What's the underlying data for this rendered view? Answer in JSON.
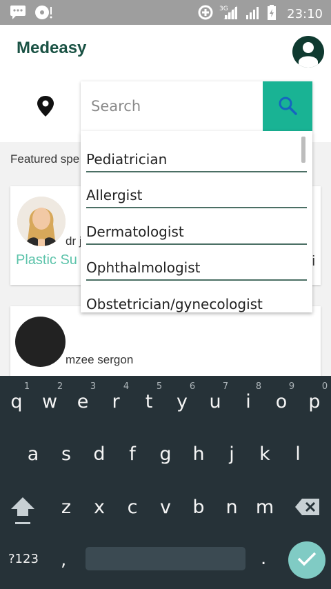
{
  "status_bar": {
    "time": "23:10",
    "network": "3G",
    "icons": [
      "chat-icon",
      "cd-icon",
      "data-saver-icon",
      "signal-icon",
      "signal-icon",
      "battery-icon"
    ]
  },
  "app": {
    "title": "Medeasy"
  },
  "search": {
    "placeholder": "Search"
  },
  "featured": {
    "label": "Featured spe"
  },
  "doctors": [
    {
      "name": "dr j",
      "specialty": "Plastic Su",
      "trailing": "i"
    },
    {
      "name": "mzee sergon"
    }
  ],
  "suggestions": [
    "Pediatrician",
    "Allergist",
    "Dermatologist",
    "Ophthalmologist",
    "Obstetrician/gynecologist"
  ],
  "keyboard": {
    "row1": [
      "q",
      "w",
      "e",
      "r",
      "t",
      "y",
      "u",
      "i",
      "o",
      "p"
    ],
    "row1_hints": [
      "1",
      "2",
      "3",
      "4",
      "5",
      "6",
      "7",
      "8",
      "9",
      "0"
    ],
    "row2": [
      "a",
      "s",
      "d",
      "f",
      "g",
      "h",
      "j",
      "k",
      "l"
    ],
    "row3": [
      "z",
      "x",
      "c",
      "v",
      "b",
      "n",
      "m"
    ],
    "symbols_label": "?123",
    "comma": ",",
    "period": "."
  },
  "colors": {
    "status_bar": "#9e9e9e",
    "brand_text": "#1a5244",
    "accent": "#19b394",
    "specialty_text": "#5cc3aa",
    "keyboard_bg": "#263238",
    "done_button": "#80cbc4"
  }
}
